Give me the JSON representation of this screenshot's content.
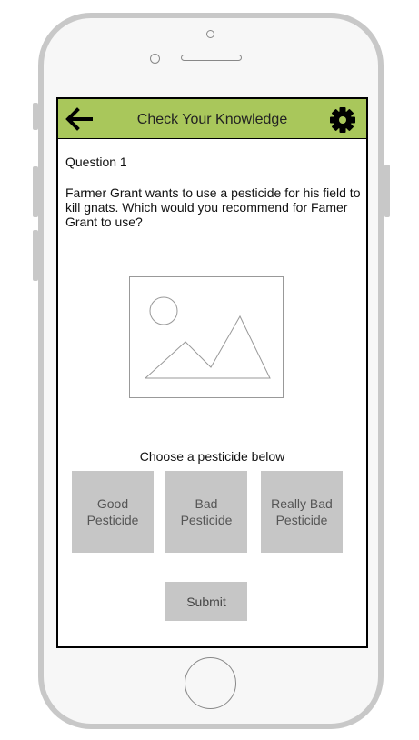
{
  "header": {
    "title": "Check Your Knowledge",
    "back_icon": "arrow-left-icon",
    "settings_icon": "gear-icon",
    "color": "#a9c75b"
  },
  "question": {
    "label": "Question 1",
    "text": "Farmer Grant wants to use a pesticide for his field to kill gnats. Which would you recommend for Famer Grant to use?",
    "image_icon": "image-placeholder-icon"
  },
  "choices": {
    "prompt": "Choose a pesticide below",
    "options": [
      {
        "label": "Good Pesticide"
      },
      {
        "label": "Bad Pesticide"
      },
      {
        "label": "Really Bad Pesticide"
      }
    ]
  },
  "submit": {
    "label": "Submit"
  },
  "colors": {
    "button_bg": "#c6c6c6",
    "frame": "#c8c8c8"
  }
}
